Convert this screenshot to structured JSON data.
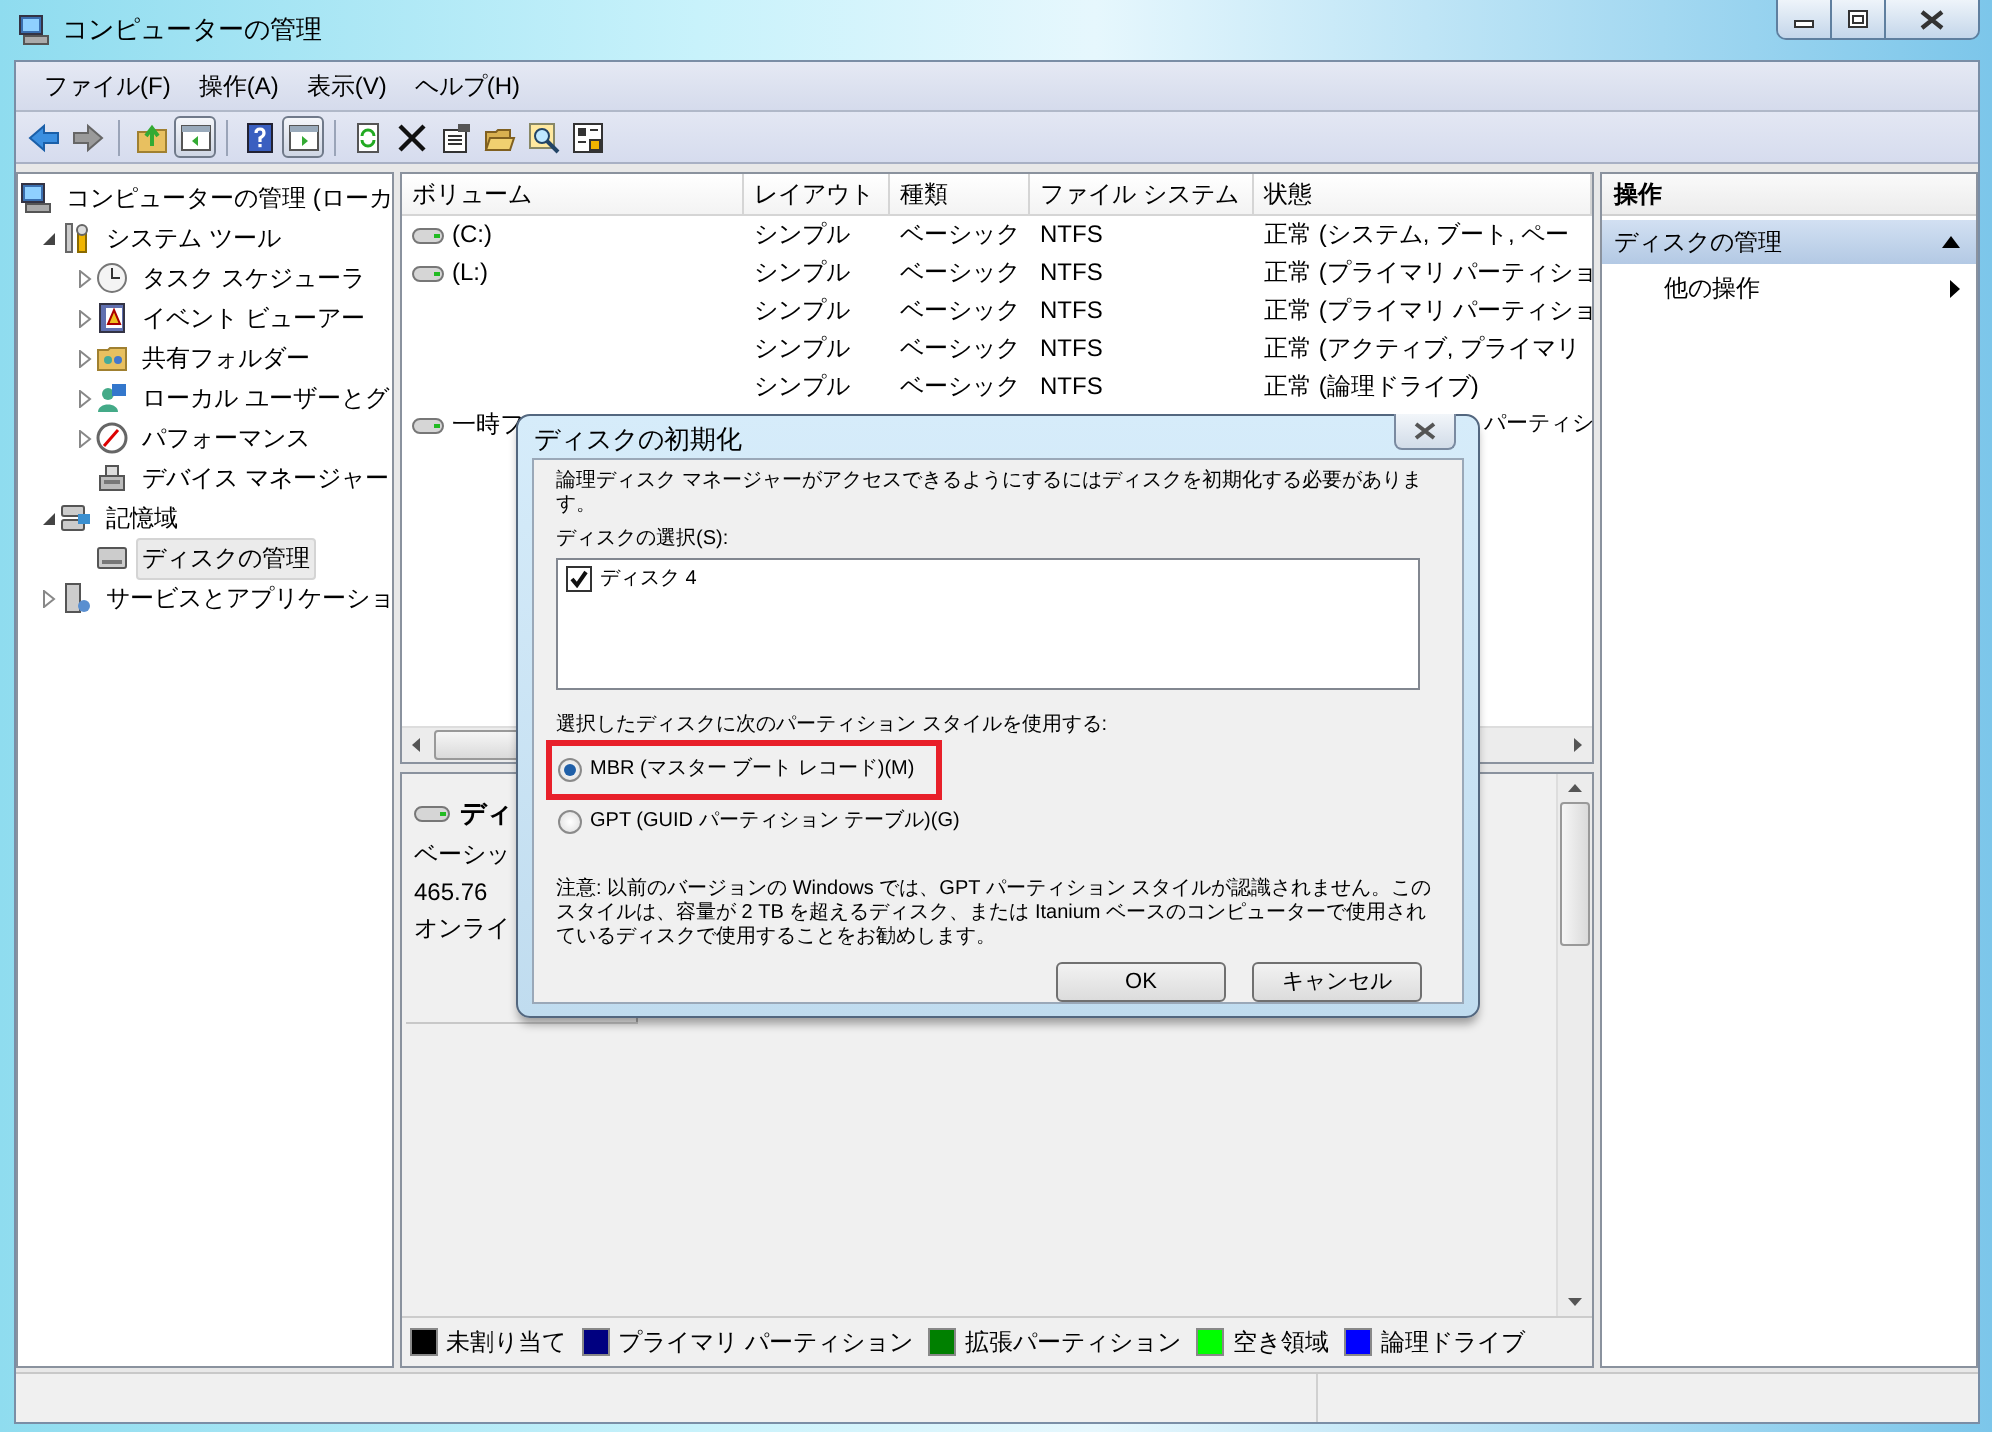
{
  "window": {
    "title": "コンピューターの管理"
  },
  "menu": [
    "ファイル(F)",
    "操作(A)",
    "表示(V)",
    "ヘルプ(H)"
  ],
  "toolbar_toggles": [
    {
      "pressed": true
    },
    {
      "pressed": true
    }
  ],
  "tree": [
    {
      "label": "コンピューターの管理 (ローカ",
      "expandable": false,
      "selected": false,
      "children": [
        {
          "label": "システム ツール",
          "expandable": true,
          "expanded": true,
          "selected": false,
          "children": [
            {
              "label": "タスク スケジューラ",
              "expandable": true,
              "expanded": false,
              "selected": false
            },
            {
              "label": "イベント ビューアー",
              "expandable": true,
              "expanded": false,
              "selected": false
            },
            {
              "label": "共有フォルダー",
              "expandable": true,
              "expanded": false,
              "selected": false
            },
            {
              "label": "ローカル ユーザーとグ",
              "expandable": true,
              "expanded": false,
              "selected": false
            },
            {
              "label": "パフォーマンス",
              "expandable": true,
              "expanded": false,
              "selected": false
            },
            {
              "label": "デバイス マネージャー",
              "expandable": false,
              "selected": false
            }
          ]
        },
        {
          "label": "記憶域",
          "expandable": true,
          "expanded": true,
          "selected": false,
          "children": [
            {
              "label": "ディスクの管理",
              "expandable": false,
              "selected": true
            }
          ]
        },
        {
          "label": "サービスとアプリケーショ",
          "expandable": true,
          "expanded": false,
          "selected": false
        }
      ]
    }
  ],
  "table": {
    "columns": [
      "ボリューム",
      "レイアウト",
      "種類",
      "ファイル システム",
      "状態"
    ],
    "rows": [
      {
        "drive_icon": true,
        "cells": [
          "(C:)",
          "シンプル",
          "ベーシック",
          "NTFS",
          "正常 (システム, ブート, ペー"
        ]
      },
      {
        "drive_icon": true,
        "cells": [
          "(L:)",
          "シンプル",
          "ベーシック",
          "NTFS",
          "正常 (プライマリ パーティショ"
        ]
      },
      {
        "drive_icon": false,
        "cells": [
          "",
          "シンプル",
          "ベーシック",
          "NTFS",
          "正常 (プライマリ パーティショ"
        ]
      },
      {
        "drive_icon": false,
        "cells": [
          "",
          "シンプル",
          "ベーシック",
          "NTFS",
          "正常 (アクティブ, プライマリ"
        ]
      },
      {
        "drive_icon": false,
        "cells": [
          "",
          "シンプル",
          "ベーシック",
          "NTFS",
          "正常 (論理ドライブ)"
        ]
      },
      {
        "drive_icon": true,
        "cells": [
          "一時フ",
          "",
          "",
          "",
          "パーティシ"
        ]
      }
    ]
  },
  "disk": {
    "name": "ディ",
    "type": "ベーシッ",
    "size": "465.76",
    "status": "オンライ"
  },
  "legend": [
    {
      "label": "未割り当て",
      "color": "#000000"
    },
    {
      "label": "プライマリ パーティション",
      "color": "#000080"
    },
    {
      "label": "拡張パーティション",
      "color": "#008000"
    },
    {
      "label": "空き領域",
      "color": "#00ff00"
    },
    {
      "label": "論理ドライブ",
      "color": "#0000ff"
    }
  ],
  "actions": {
    "title": "操作",
    "section": {
      "label": "ディスクの管理",
      "expanded": true
    },
    "items": [
      {
        "label": "他の操作"
      }
    ]
  },
  "dialog": {
    "title": "ディスクの初期化",
    "message": "論理ディスク マネージャーがアクセスできるようにするにはディスクを初期化する必要があります。",
    "disk_list_label": "ディスクの選択(S):",
    "disks": [
      {
        "label": "ディスク 4",
        "checked": true
      }
    ],
    "style_label": "選択したディスクに次のパーティション スタイルを使用する:",
    "styles": [
      {
        "label": "MBR (マスター ブート レコード)(M)",
        "selected": true,
        "highlighted": true
      },
      {
        "label": "GPT (GUID パーティション テーブル)(G)",
        "selected": false,
        "highlighted": false
      }
    ],
    "note": "注意: 以前のバージョンの Windows では、GPT パーティション スタイルが認識されません。このスタイルは、容量が 2 TB を超えるディスク、または Itanium ベースのコンピューターで使用されているディスクで使用することをお勧めします。",
    "buttons": [
      "OK",
      "キャンセル"
    ]
  }
}
